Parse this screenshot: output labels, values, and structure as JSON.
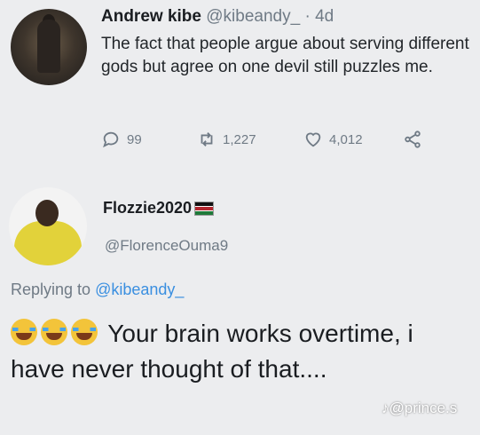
{
  "tweet": {
    "author_name": "Andrew kibe",
    "author_handle": "@kibeandy_",
    "time": "· 4d",
    "text": "The fact that people argue about serving different gods but agree on one devil still puzzles me.",
    "actions": {
      "replies": "99",
      "retweets": "1,227",
      "likes": "4,012"
    }
  },
  "reply": {
    "author_name": "Flozzie2020",
    "author_handle": "@FlorenceOuma9",
    "replying_prefix": "Replying to",
    "replying_to": "@kibeandy_",
    "text": "Your brain works overtime, i have never thought of that...."
  },
  "watermark": {
    "text": "@prince.s"
  },
  "icons": [
    "reply-icon",
    "retweet-icon",
    "like-icon",
    "share-icon",
    "tiktok-icon"
  ]
}
